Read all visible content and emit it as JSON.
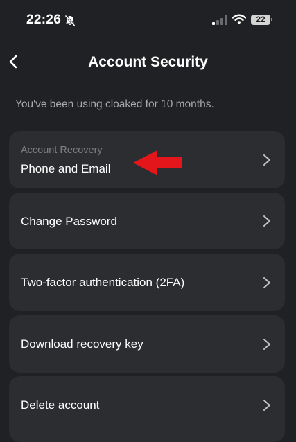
{
  "status_bar": {
    "time": "22:26",
    "battery": "22",
    "icons": [
      "bell-slash-icon",
      "cellular-signal-icon",
      "wifi-icon",
      "battery-icon"
    ]
  },
  "header": {
    "title": "Account Security",
    "back_icon": "chevron-left-icon"
  },
  "subtitle": "You've been using cloaked for 10 months.",
  "items": [
    {
      "caption": "Account Recovery",
      "label": "Phone and Email"
    },
    {
      "label": "Change Password"
    },
    {
      "label": "Two-factor authentication (2FA)"
    },
    {
      "label": "Download recovery key"
    },
    {
      "label": "Delete account"
    }
  ],
  "annotation": {
    "icon": "red-arrow-icon",
    "color": "#e3161b"
  },
  "colors": {
    "background": "#202124",
    "card": "#2c2d30",
    "text": "#ffffff",
    "muted": "#a9aaad"
  }
}
